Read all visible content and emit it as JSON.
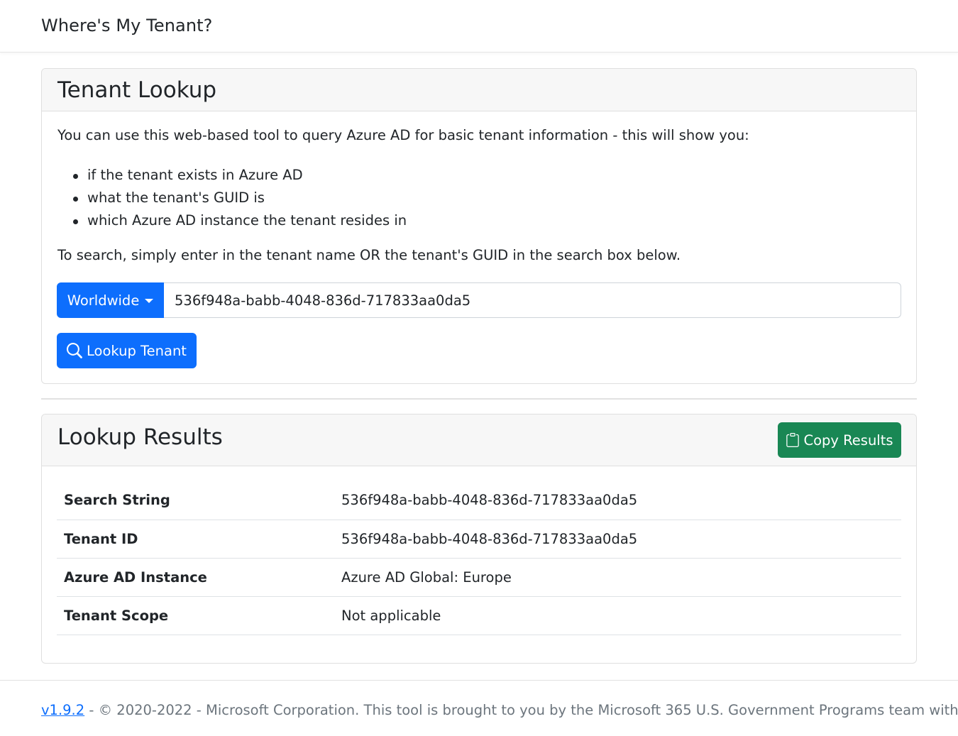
{
  "navbar": {
    "brand": "Where's My Tenant?"
  },
  "lookup": {
    "title": "Tenant Lookup",
    "intro": "You can use this web-based tool to query Azure AD for basic tenant information - this will show you:",
    "bullets": [
      "if the tenant exists in Azure AD",
      "what the tenant's GUID is",
      "which Azure AD instance the tenant resides in"
    ],
    "instructions": "To search, simply enter in the tenant name OR the tenant's GUID in the search box below.",
    "cloud_dropdown": "Worldwide",
    "search_value": "536f948a-babb-4048-836d-717833aa0da5",
    "lookup_button": "Lookup Tenant"
  },
  "results": {
    "title": "Lookup Results",
    "copy_button": "Copy Results",
    "rows": [
      {
        "label": "Search String",
        "value": "536f948a-babb-4048-836d-717833aa0da5"
      },
      {
        "label": "Tenant ID",
        "value": "536f948a-babb-4048-836d-717833aa0da5"
      },
      {
        "label": "Azure AD Instance",
        "value": "Azure AD Global: Europe"
      },
      {
        "label": "Tenant Scope",
        "value": "Not applicable"
      }
    ]
  },
  "footer": {
    "version_link": "v1.9.2",
    "text": " - © 2020-2022 - Microsoft Corporation. This tool is brought to you by the Microsoft 365 U.S. Government Programs team with ",
    "heart_icon": "heart-icon"
  },
  "colors": {
    "primary": "#0d6efd",
    "success": "#198754",
    "heart": "#dc3545",
    "muted": "#6c757d"
  }
}
